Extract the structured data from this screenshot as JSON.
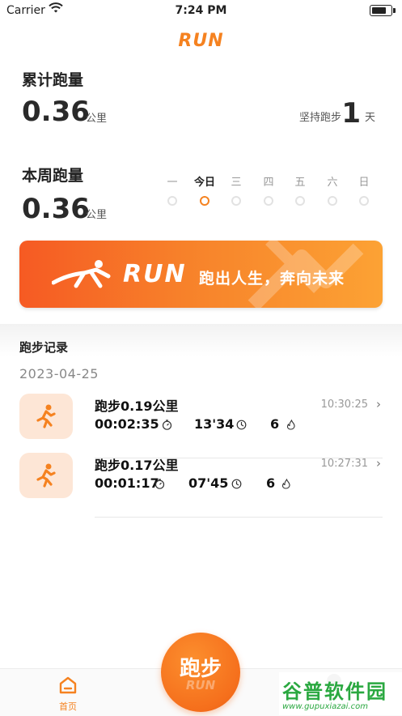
{
  "status_bar": {
    "carrier": "Carrier",
    "time": "7:24 PM"
  },
  "header": {
    "logo_text": "RUN"
  },
  "total": {
    "title": "累计跑量",
    "value": "0.36",
    "unit": "公里",
    "streak_label": "坚持跑步",
    "streak_value": "1",
    "streak_unit": "天"
  },
  "weekly": {
    "title": "本周跑量",
    "value": "0.36",
    "unit": "公里",
    "days": [
      "一",
      "今日",
      "三",
      "四",
      "五",
      "六",
      "日"
    ],
    "today_index": 1
  },
  "banner": {
    "logo_text": "RUN",
    "slogan": "跑出人生，奔向未来"
  },
  "records": {
    "title": "跑步记录",
    "date": "2023-04-25",
    "items": [
      {
        "title": "跑步0.19公里",
        "time": "10:30:25",
        "duration": "00:02:35",
        "pace": "13'34",
        "calories": "6"
      },
      {
        "title": "跑步0.17公里",
        "time": "10:27:31",
        "duration": "00:01:17",
        "pace": "07'45",
        "calories": "6"
      }
    ]
  },
  "tabbar": {
    "home_label": "首页",
    "run_label": "跑步",
    "run_sub": "RUN"
  },
  "watermark": {
    "title": "谷普软件园",
    "url": "www.gupuxiazai.com"
  },
  "colors": {
    "accent": "#f58220",
    "icon_bg": "#fde6d6",
    "watermark": "#2aa840"
  }
}
